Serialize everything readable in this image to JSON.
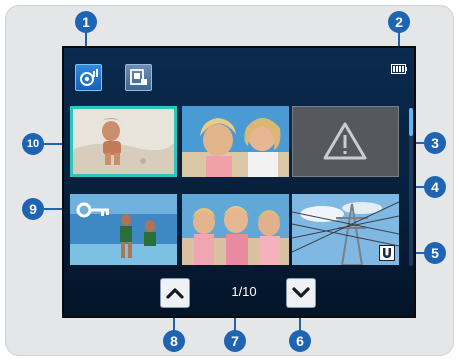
{
  "screen": {
    "page_counter": "1/10",
    "mode_buttons": [
      {
        "name": "video-mode-icon",
        "selected": true
      },
      {
        "name": "photo-mode-icon",
        "selected": false
      }
    ],
    "battery_icon": "battery-full-icon",
    "thumbnails": [
      {
        "label": "",
        "content": "selected",
        "selected": true
      },
      {
        "label": "",
        "content": "photo"
      },
      {
        "label": "",
        "content": "error-warning-icon"
      },
      {
        "label": "",
        "content": "protect-key-icon"
      },
      {
        "label": "",
        "content": "photo"
      },
      {
        "label": "",
        "content": "magnet-icon"
      }
    ],
    "nav_icons": {
      "up": "chevron-up-icon",
      "down": "chevron-down-icon"
    }
  },
  "callouts": {
    "c1": "1",
    "c2": "2",
    "c3": "3",
    "c4": "4",
    "c5": "5",
    "c6": "6",
    "c7": "7",
    "c8": "8",
    "c9": "9",
    "c10": "10"
  },
  "colors": {
    "callout": "#1f64b3",
    "screen_bg": "#07203c",
    "selection_border": "#2ec4c0",
    "panel_bg": "#e4e6e8"
  }
}
